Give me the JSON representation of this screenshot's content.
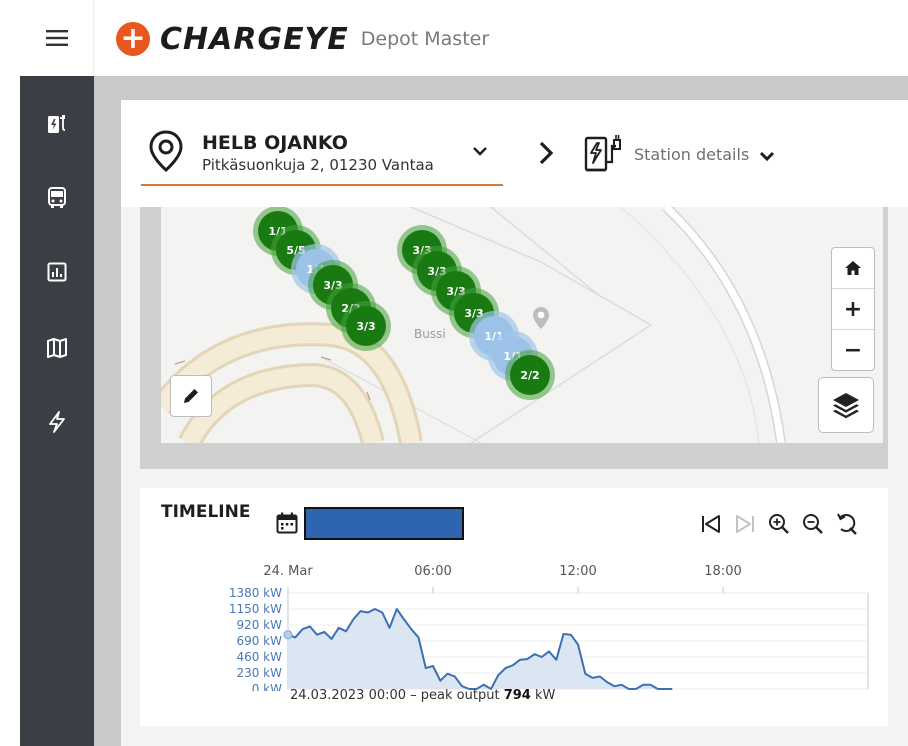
{
  "app": {
    "brand_name": "CHARGEYE",
    "product_name": "Depot Master",
    "brand_color": "#e8571e",
    "brand_symbol": "+"
  },
  "sidebar": {
    "items": [
      {
        "name": "charging-icon"
      },
      {
        "name": "bus-icon"
      },
      {
        "name": "report-icon"
      },
      {
        "name": "map-icon"
      },
      {
        "name": "energy-icon"
      }
    ]
  },
  "location": {
    "title": "HELB OJANKO",
    "address": "Pitkäsuonkuja 2, 01230 Vantaa"
  },
  "station": {
    "label": "Station details"
  },
  "map": {
    "poi_label": "Bussi",
    "clusters": [
      {
        "label": "1/1",
        "color": "green"
      },
      {
        "label": "5/5",
        "color": "green"
      },
      {
        "label": "1/1",
        "color": "blue"
      },
      {
        "label": "3/3",
        "color": "green"
      },
      {
        "label": "2/2",
        "color": "green"
      },
      {
        "label": "3/3",
        "color": "green"
      },
      {
        "label": "3/3",
        "color": "green"
      },
      {
        "label": "3/3",
        "color": "green"
      },
      {
        "label": "3/3",
        "color": "green"
      },
      {
        "label": "3/3",
        "color": "green"
      },
      {
        "label": "1/1",
        "color": "blue"
      },
      {
        "label": "1/1",
        "color": "blue"
      },
      {
        "label": "2/2",
        "color": "green"
      }
    ],
    "controls": {
      "zoom_in": "+",
      "zoom_out": "−"
    }
  },
  "timeline": {
    "title": "TIMELINE",
    "caption_prefix": "24.03.2023 00:00 – peak output ",
    "peak_value": "794",
    "peak_unit": " kW"
  },
  "chart_data": {
    "type": "area",
    "title": "",
    "xlabel": "",
    "ylabel": "",
    "x_ticks": [
      "24. Mar",
      "06:00",
      "12:00",
      "18:00"
    ],
    "y_ticks": [
      "0 kW",
      "230 kW",
      "460 kW",
      "690 kW",
      "920 kW",
      "1150 kW",
      "1380 kW"
    ],
    "ylim": [
      0,
      1380
    ],
    "xlim_hours": [
      0,
      24
    ],
    "series": [
      {
        "x_hours": [
          0,
          0.3,
          0.6,
          0.9,
          1.2,
          1.5,
          1.8,
          2.1,
          2.4,
          2.7,
          3.0,
          3.3,
          3.6,
          3.9,
          4.2,
          4.5,
          4.8,
          5.1,
          5.4,
          5.7,
          6.0,
          6.3,
          6.6,
          6.9,
          7.2,
          7.5,
          7.8,
          8.1,
          8.4,
          8.7,
          9.0,
          9.3,
          9.6,
          9.9,
          10.2,
          10.5,
          10.8,
          11.1,
          11.4,
          11.7,
          12.0,
          12.3,
          12.6,
          12.9,
          13.2,
          13.5,
          13.8,
          14.1,
          14.4,
          14.7,
          15.0,
          15.3,
          15.6,
          15.9
        ],
        "values": [
          780,
          740,
          860,
          900,
          780,
          820,
          720,
          880,
          830,
          1000,
          1120,
          1100,
          1150,
          1100,
          880,
          1150,
          1000,
          860,
          740,
          300,
          330,
          120,
          220,
          180,
          40,
          0,
          0,
          60,
          0,
          200,
          300,
          340,
          420,
          430,
          500,
          460,
          540,
          420,
          790,
          780,
          640,
          220,
          160,
          180,
          100,
          40,
          60,
          0,
          0,
          60,
          60,
          0,
          0,
          0
        ]
      }
    ],
    "grid": true,
    "fill_color": "#dbe6f2",
    "line_color": "#3c6fb5"
  }
}
